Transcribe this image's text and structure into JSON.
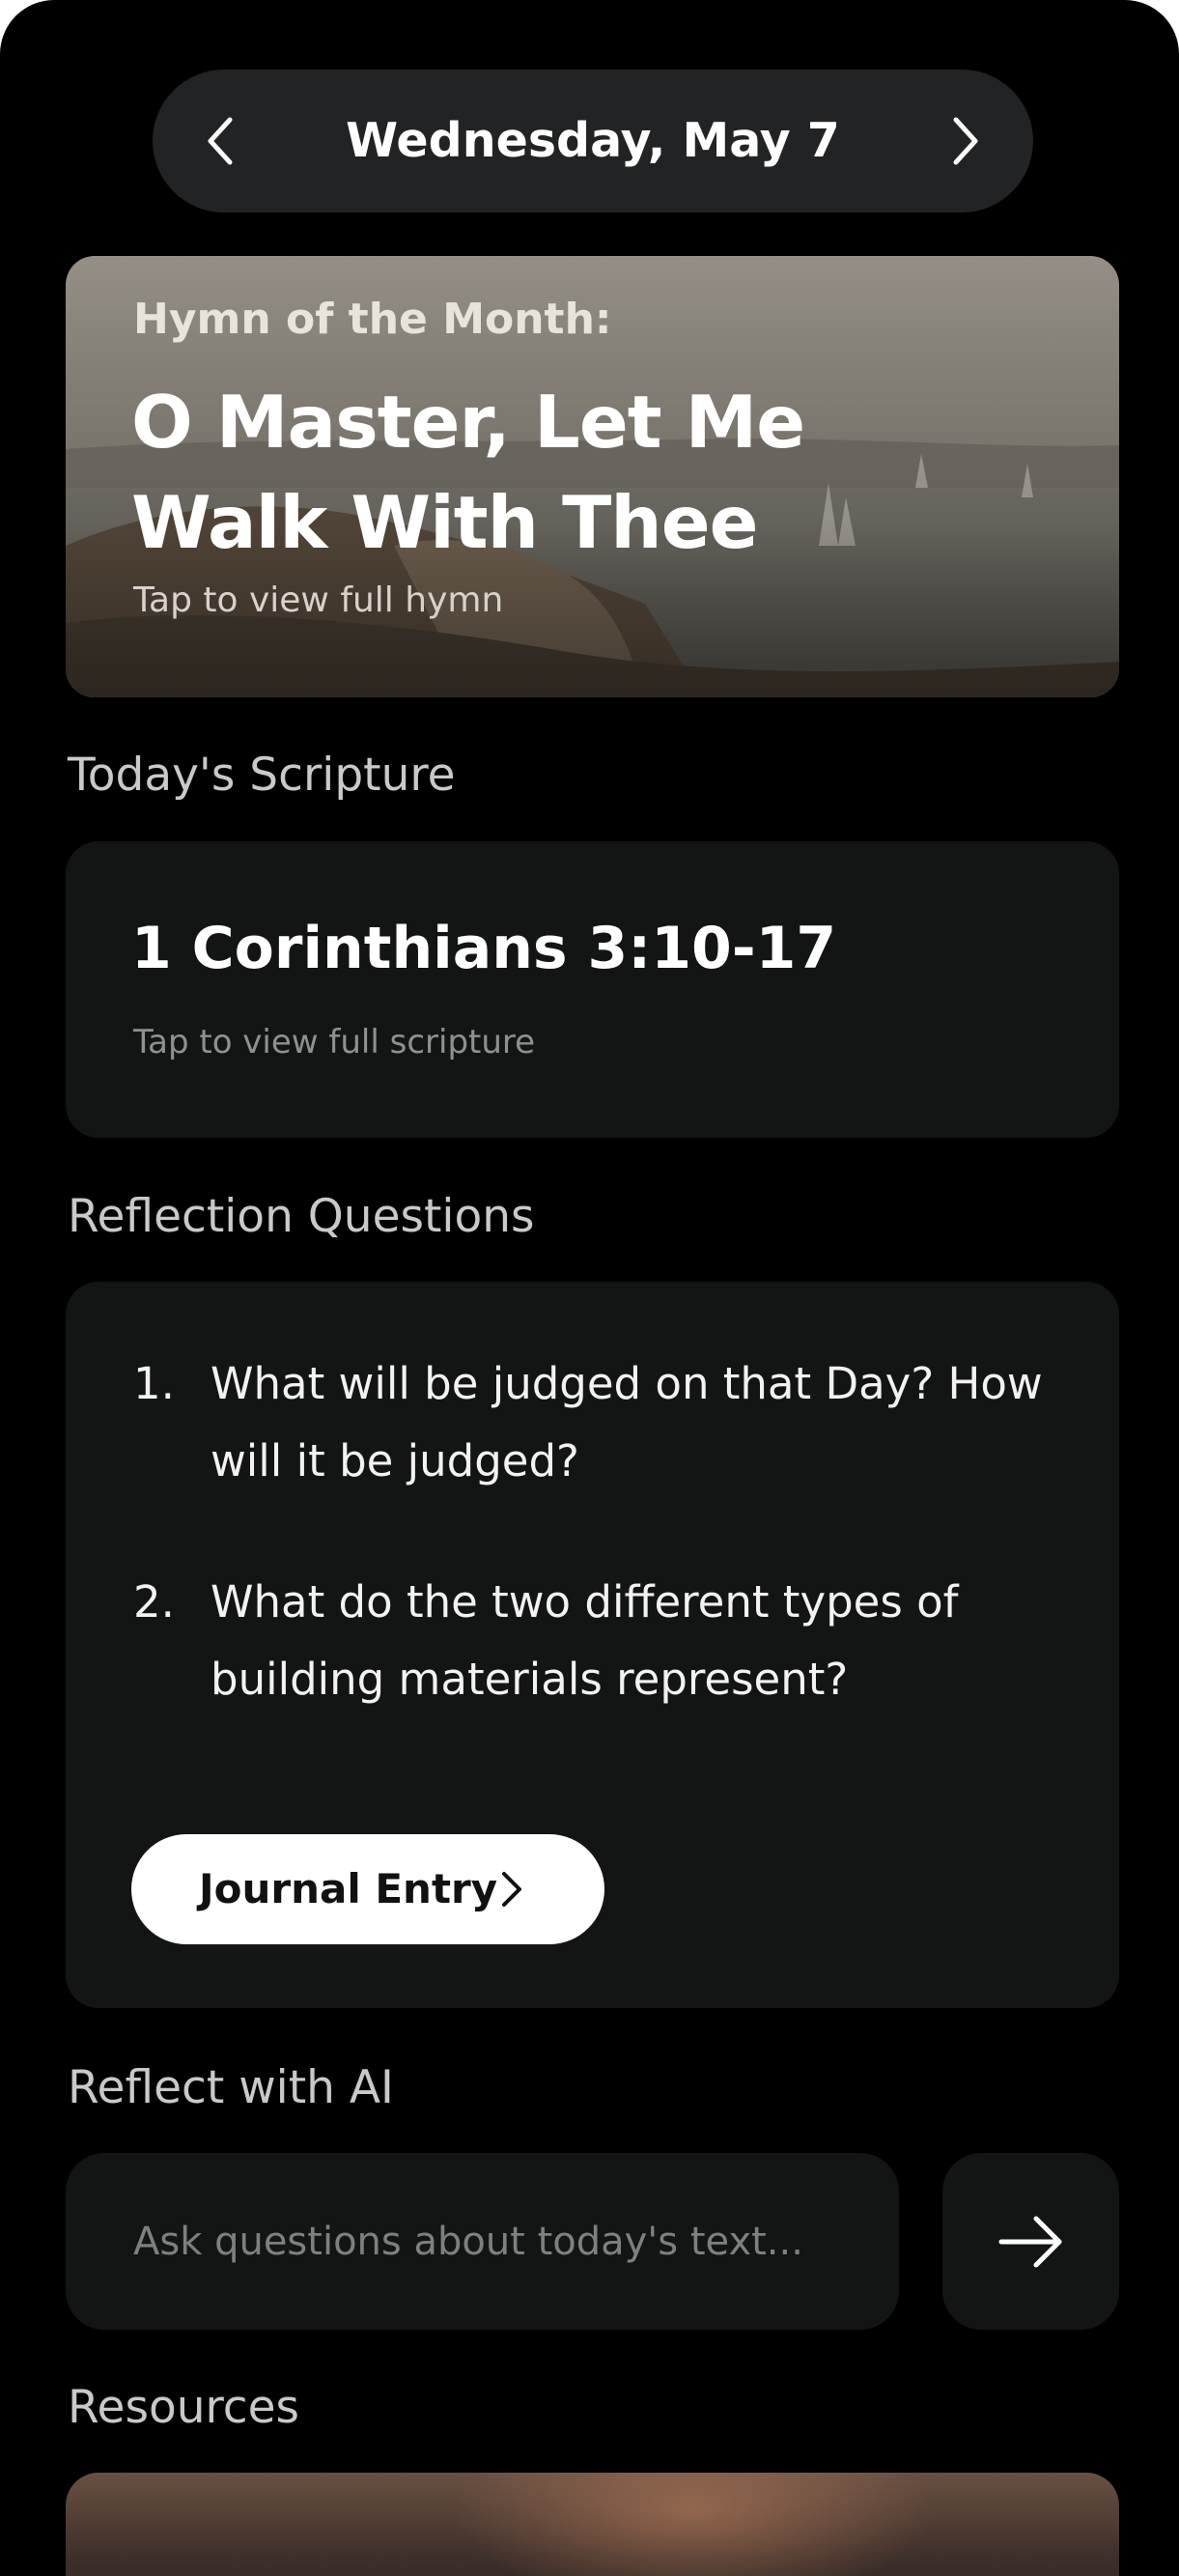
{
  "header": {
    "date": "Wednesday, May 7",
    "prev_icon": "chevron-left-icon",
    "next_icon": "chevron-right-icon"
  },
  "hymn": {
    "kicker": "Hymn of the Month:",
    "title": "O Master, Let Me Walk With Thee",
    "hint": "Tap to view full hymn"
  },
  "scripture": {
    "section_title": "Today's Scripture",
    "reference": "1 Corinthians 3:10-17",
    "hint": "Tap to view full scripture"
  },
  "reflection": {
    "section_title": "Reflection Questions",
    "questions": [
      {
        "number": "1.",
        "text": "What will be judged on that Day? How will it be judged?"
      },
      {
        "number": "2.",
        "text": "What do the two different types of building materials represent?"
      }
    ],
    "journal_button": "Journal Entry",
    "journal_icon": "chevron-right-icon"
  },
  "ai": {
    "section_title": "Reflect with AI",
    "placeholder": "Ask questions about today's text...",
    "value": "",
    "send_icon": "arrow-right-icon"
  },
  "resources": {
    "section_title": "Resources"
  },
  "colors": {
    "background": "#000000",
    "card": "#131414",
    "pill": "#222324",
    "text_primary": "#ffffff",
    "text_muted": "#8f9090"
  }
}
